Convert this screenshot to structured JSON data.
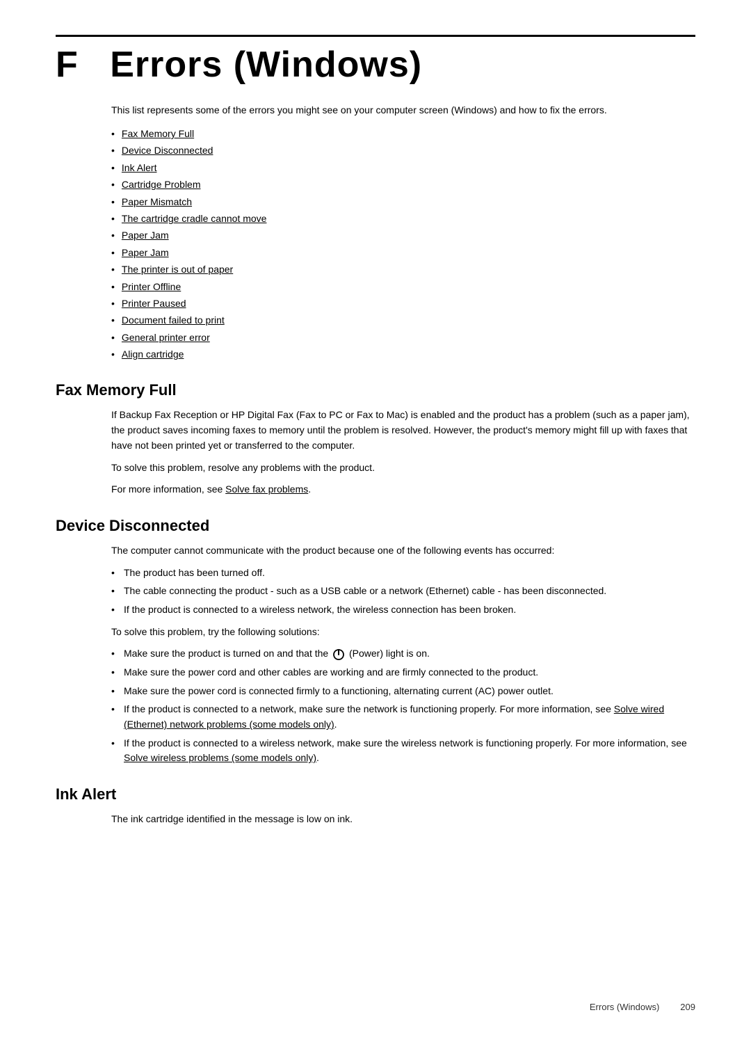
{
  "page": {
    "top_border": true,
    "chapter_letter": "F",
    "chapter_title": "Errors (Windows)",
    "intro_text": "This list represents some of the errors you might see on your computer screen (Windows) and how to fix the errors.",
    "toc_items": [
      "Fax Memory Full",
      "Device Disconnected",
      "Ink Alert",
      "Cartridge Problem",
      "Paper Mismatch",
      "The cartridge cradle cannot move",
      "Paper Jam",
      "Paper Jam",
      "The printer is out of paper",
      "Printer Offline",
      "Printer Paused",
      "Document failed to print",
      "General printer error",
      "Align cartridge"
    ],
    "sections": [
      {
        "id": "fax-memory-full",
        "heading": "Fax Memory Full",
        "paragraphs": [
          "If Backup Fax Reception or HP Digital Fax (Fax to PC or Fax to Mac) is enabled and the product has a problem (such as a paper jam), the product saves incoming faxes to memory until the problem is resolved. However, the product's memory might fill up with faxes that have not been printed yet or transferred to the computer.",
          "To solve this problem, resolve any problems with the product.",
          "For more information, see Solve fax problems."
        ],
        "has_link_in": [
          2
        ],
        "link_texts": [
          "Solve fax problems"
        ]
      },
      {
        "id": "device-disconnected",
        "heading": "Device Disconnected",
        "intro": "The computer cannot communicate with the product because one of the following events has occurred:",
        "bullets_1": [
          "The product has been turned off.",
          "The cable connecting the product - such as a USB cable or a network (Ethernet) cable - has been disconnected.",
          "If the product is connected to a wireless network, the wireless connection has been broken."
        ],
        "solve_text": "To solve this problem, try the following solutions:",
        "bullets_2": [
          "Make sure the product is turned on and that the [POWER_ICON] (Power) light is on.",
          "Make sure the power cord and other cables are working and are firmly connected to the product.",
          "Make sure the power cord is connected firmly to a functioning, alternating current (AC) power outlet.",
          "If the product is connected to a network, make sure the network is functioning properly. For more information, see Solve wired (Ethernet) network problems (some models only).",
          "If the product is connected to a wireless network, make sure the wireless network is functioning properly. For more information, see Solve wireless problems (some models only)."
        ]
      },
      {
        "id": "ink-alert",
        "heading": "Ink Alert",
        "paragraphs": [
          "The ink cartridge identified in the message is low on ink."
        ]
      }
    ],
    "footer": {
      "section_label": "Errors (Windows)",
      "page_number": "209"
    }
  }
}
